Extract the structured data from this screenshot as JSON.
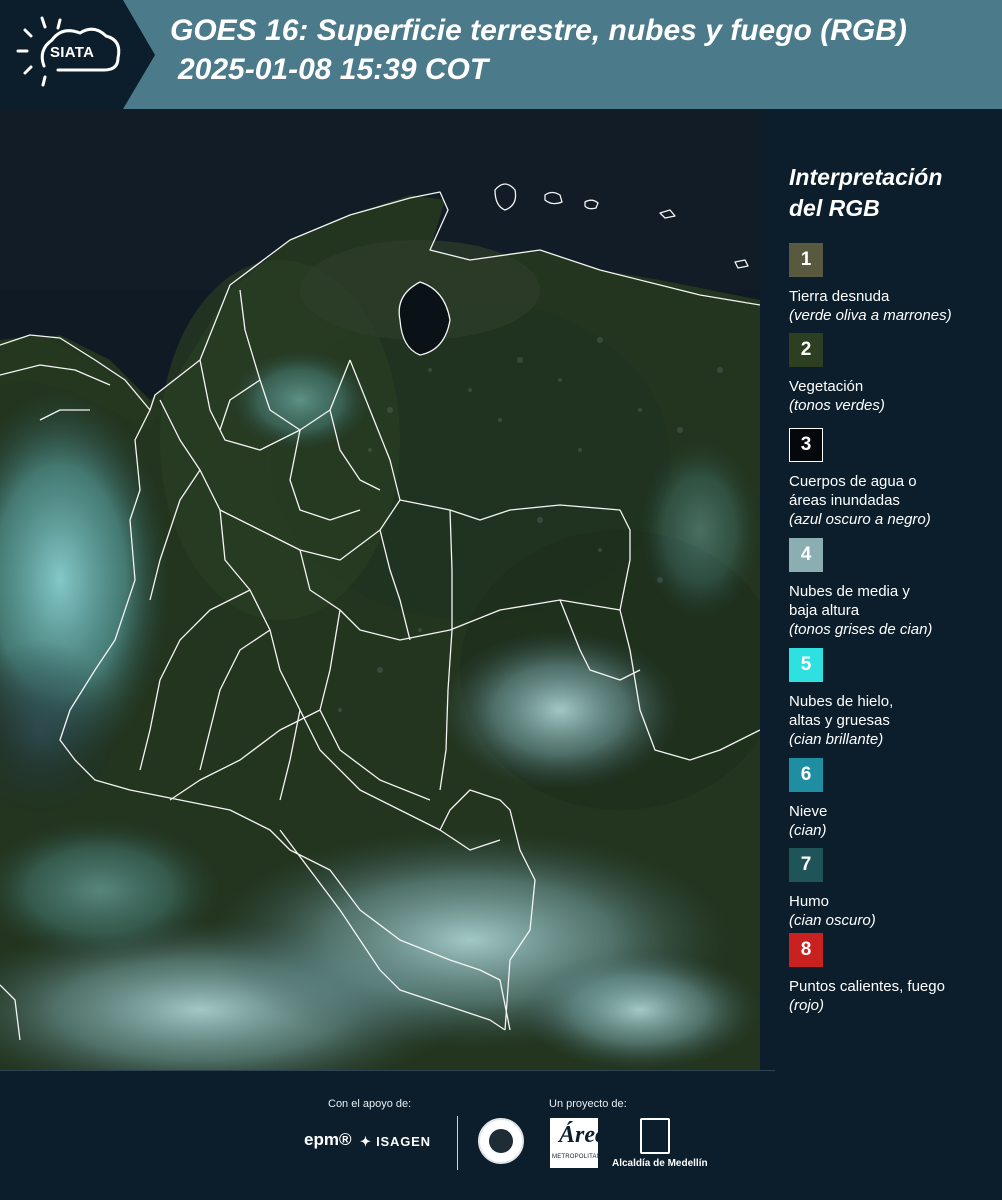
{
  "header": {
    "logo_text": "SIATA",
    "title_line1": "GOES 16: Superficie terrestre, nubes y fuego (RGB)",
    "title_line2": "2025-01-08 15:39 COT"
  },
  "legend": {
    "title_line1": "Interpretación",
    "title_line2": "del RGB",
    "items": [
      {
        "number": "1",
        "label_lines": [
          "Tierra desnuda"
        ],
        "desc": "(verde oliva a marrones)",
        "color": "#59593f"
      },
      {
        "number": "2",
        "label_lines": [
          "Vegetación"
        ],
        "desc": "(tonos verdes)",
        "color": "#2c3f21"
      },
      {
        "number": "3",
        "label_lines": [
          "Cuerpos de agua o",
          "áreas inundadas"
        ],
        "desc": "(azul oscuro a negro)",
        "color": "#05080b"
      },
      {
        "number": "4",
        "label_lines": [
          "Nubes de media y",
          "baja altura"
        ],
        "desc": "(tonos grises de cian)",
        "color": "#8aaeb1"
      },
      {
        "number": "5",
        "label_lines": [
          "Nubes de hielo,",
          "altas y gruesas"
        ],
        "desc": "(cian brillante)",
        "color": "#2ee0e0"
      },
      {
        "number": "6",
        "label_lines": [
          "Nieve"
        ],
        "desc": "(cian)",
        "color": "#1f8ea3"
      },
      {
        "number": "7",
        "label_lines": [
          "Humo"
        ],
        "desc": "(cian oscuro)",
        "color": "#1f5559"
      },
      {
        "number": "8",
        "label_lines": [
          "Puntos calientes, fuego"
        ],
        "desc": "(rojo)",
        "color": "#c8211f"
      }
    ]
  },
  "footer": {
    "support_label": "Con el apoyo de:",
    "project_label": "Un proyecto de:",
    "epm_text": "epm®",
    "isagen_text": "ISAGEN",
    "area_text": "Área",
    "area_subtext": "METROPOLITANA",
    "alcaldia_text": "Alcaldía de Medellín"
  }
}
